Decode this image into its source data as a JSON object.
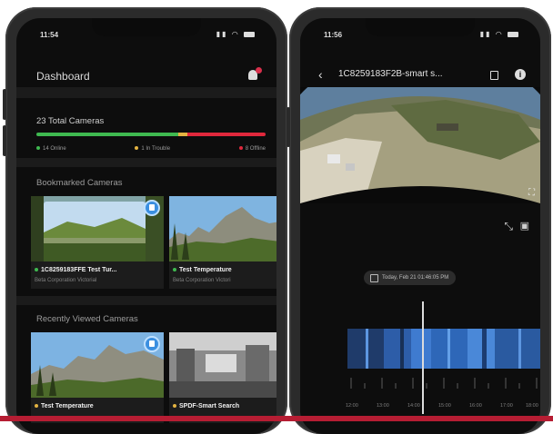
{
  "left_phone": {
    "status": {
      "time": "11:54"
    },
    "header": {
      "title": "Dashboard"
    },
    "summary": {
      "total": "23 Total Cameras",
      "online": "14 Online",
      "trouble": "1 In Trouble",
      "offline": "8 Offline",
      "colors": {
        "online": "#3fb950",
        "trouble": "#e3b341",
        "offline": "#e0283c"
      }
    },
    "bookmarked": {
      "title": "Bookmarked Cameras",
      "cards": [
        {
          "name": "1C8259183FFE Test Tur...",
          "org": "Beta Corporation Victorial",
          "status_color": "#3fb950"
        },
        {
          "name": "Test Temperature",
          "org": "Beta Corporation Victori",
          "status_color": "#3fb950"
        }
      ]
    },
    "recent": {
      "title": "Recently Viewed Cameras",
      "cards": [
        {
          "name": "Test Temperature",
          "status_color": "#e3b341"
        },
        {
          "name": "SPDF-Smart Search",
          "status_color": "#e3b341"
        }
      ]
    }
  },
  "right_phone": {
    "status": {
      "time": "11:56"
    },
    "header": {
      "title": "1C8259183F2B-smart s..."
    },
    "date_pill": "Today, Feb 21 01:46:05 PM",
    "timeline_labels": [
      "12:00",
      "13:00",
      "14:00",
      "15:00",
      "16:00",
      "17:00",
      "18:00"
    ]
  }
}
